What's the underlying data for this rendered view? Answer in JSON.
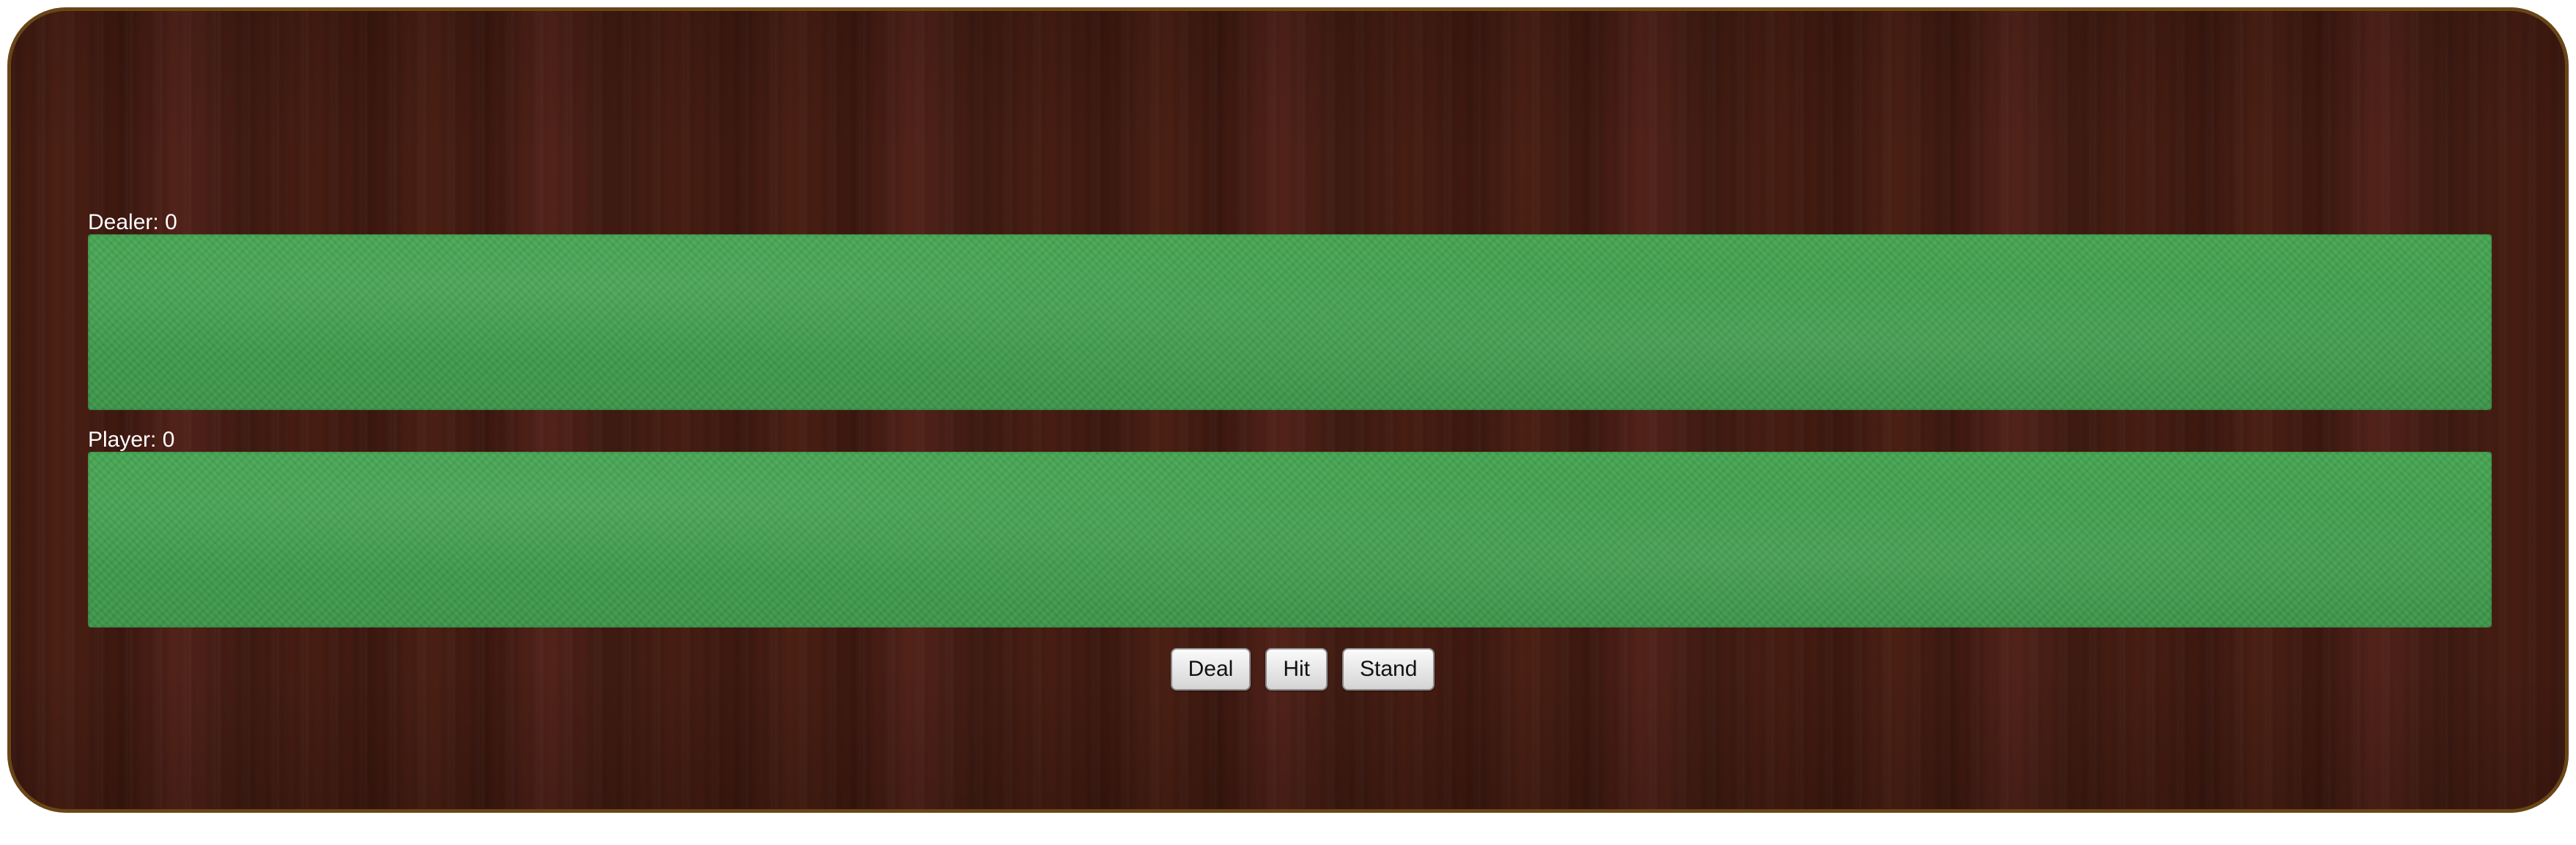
{
  "dealer": {
    "label": "Dealer:",
    "score": "0"
  },
  "player": {
    "label": "Player:",
    "score": "0"
  },
  "controls": {
    "deal_label": "Deal",
    "hit_label": "Hit",
    "stand_label": "Stand"
  },
  "colors": {
    "felt": "#3f9a4c",
    "table_wood": "#3a1810",
    "table_border": "#6a4516"
  }
}
